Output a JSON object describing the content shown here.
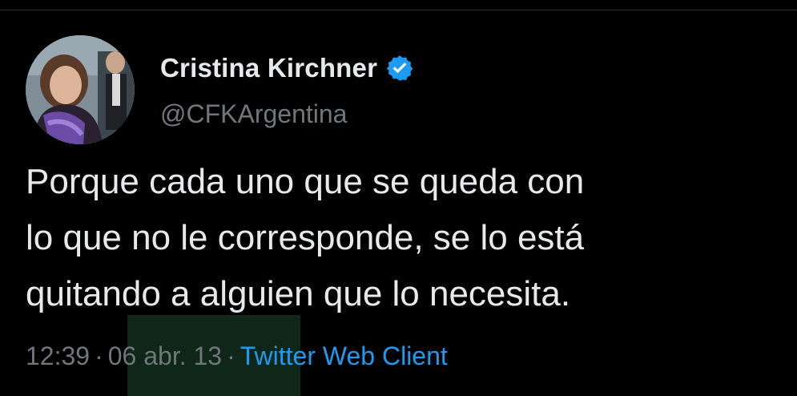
{
  "author": {
    "name": "Cristina Kirchner",
    "handle": "@CFKArgentina",
    "verified": true
  },
  "tweet": {
    "lines": [
      "Porque cada uno que se queda con",
      "lo que no le corresponde, se lo está",
      "quitando a alguien que lo necesita."
    ]
  },
  "meta": {
    "time": "12:39",
    "separator": "·",
    "date": "06 abr. 13",
    "client": "Twitter Web Client"
  },
  "colors": {
    "background": "#000000",
    "text": "#e7e9ea",
    "secondary": "#71767b",
    "link": "#1d9bf0",
    "verified_badge": "#1d9bf0",
    "highlight": "#0e2718"
  },
  "icons": {
    "verified": "verified-badge-icon"
  }
}
